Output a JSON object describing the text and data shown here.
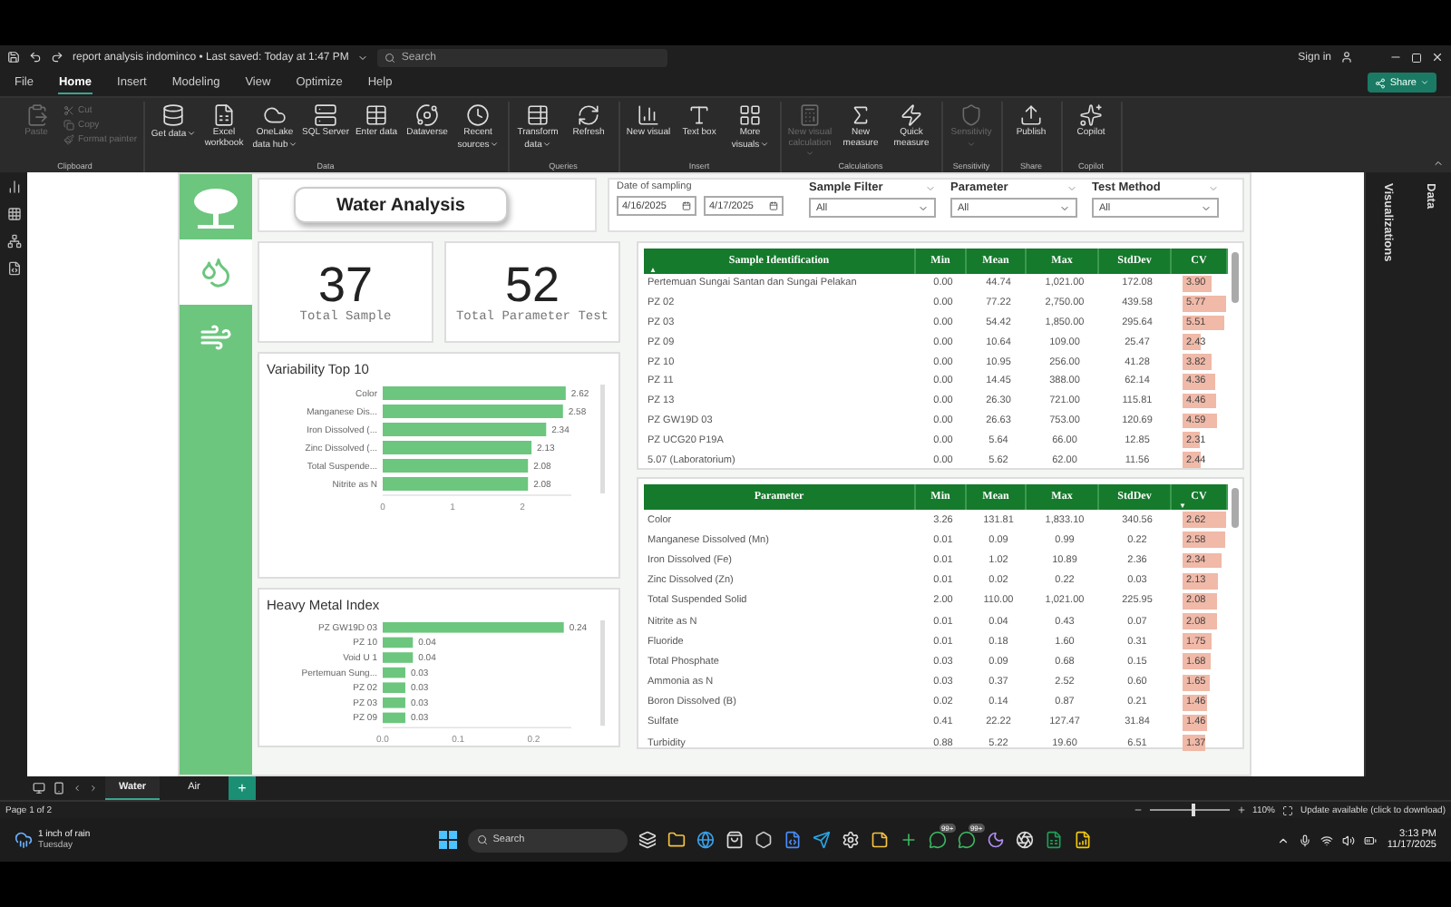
{
  "title_bar": {
    "title": "report analysis indominco • Last saved: Today at 1:47 PM",
    "search_placeholder": "Search",
    "sign_in": "Sign in"
  },
  "menu": [
    {
      "label": "File",
      "selected": false
    },
    {
      "label": "Home",
      "selected": true
    },
    {
      "label": "Insert",
      "selected": false
    },
    {
      "label": "Modeling",
      "selected": false
    },
    {
      "label": "View",
      "selected": false
    },
    {
      "label": "Optimize",
      "selected": false
    },
    {
      "label": "Help",
      "selected": false
    }
  ],
  "share_button": "Share",
  "ribbon": [
    {
      "group": "Clipboard",
      "buttons": [
        {
          "label": "Paste",
          "kind": "large",
          "disabled": true,
          "dropdown": false
        },
        {
          "label": "Cut",
          "kind": "small",
          "disabled": true
        },
        {
          "label": "Copy",
          "kind": "small",
          "disabled": true
        },
        {
          "label": "Format painter",
          "kind": "small",
          "disabled": true
        }
      ]
    },
    {
      "group": "Data",
      "buttons": [
        {
          "label": "Get data",
          "kind": "large",
          "disabled": false,
          "dropdown": true
        },
        {
          "label": "Excel workbook",
          "kind": "large",
          "disabled": false,
          "dropdown": false
        },
        {
          "label": "OneLake data hub",
          "kind": "large",
          "disabled": false,
          "dropdown": true
        },
        {
          "label": "SQL Server",
          "kind": "large",
          "disabled": false,
          "dropdown": false
        },
        {
          "label": "Enter data",
          "kind": "large",
          "disabled": false,
          "dropdown": false
        },
        {
          "label": "Dataverse",
          "kind": "large",
          "disabled": false,
          "dropdown": false
        },
        {
          "label": "Recent sources",
          "kind": "large",
          "disabled": false,
          "dropdown": true
        }
      ]
    },
    {
      "group": "Queries",
      "buttons": [
        {
          "label": "Transform data",
          "kind": "large",
          "disabled": false,
          "dropdown": true
        },
        {
          "label": "Refresh",
          "kind": "large",
          "disabled": false,
          "dropdown": false
        }
      ]
    },
    {
      "group": "Insert",
      "buttons": [
        {
          "label": "New visual",
          "kind": "large",
          "disabled": false,
          "dropdown": false
        },
        {
          "label": "Text box",
          "kind": "large",
          "disabled": false,
          "dropdown": false
        },
        {
          "label": "More visuals",
          "kind": "large",
          "disabled": false,
          "dropdown": true
        }
      ]
    },
    {
      "group": "Calculations",
      "buttons": [
        {
          "label": "New visual calculation",
          "kind": "large",
          "disabled": true,
          "dropdown": true
        },
        {
          "label": "New measure",
          "kind": "large",
          "disabled": false,
          "dropdown": false
        },
        {
          "label": "Quick measure",
          "kind": "large",
          "disabled": false,
          "dropdown": false
        }
      ]
    },
    {
      "group": "Sensitivity",
      "buttons": [
        {
          "label": "Sensitivity",
          "kind": "large",
          "disabled": true,
          "dropdown": true
        }
      ]
    },
    {
      "group": "Share",
      "buttons": [
        {
          "label": "Publish",
          "kind": "large",
          "disabled": false,
          "dropdown": false
        }
      ]
    },
    {
      "group": "Copilot",
      "buttons": [
        {
          "label": "Copilot",
          "kind": "large",
          "disabled": false,
          "dropdown": false
        }
      ]
    }
  ],
  "report": {
    "title": "Water Analysis",
    "nav_buttons": [
      {
        "kind": "water",
        "selected": true
      },
      {
        "kind": "air",
        "selected": false
      }
    ],
    "date_slicer": {
      "label": "Date of sampling",
      "from": "4/16/2025",
      "to": "4/17/2025"
    },
    "dropdowns": [
      {
        "label": "Sample Filter",
        "value": "All"
      },
      {
        "label": "Parameter",
        "value": "All"
      },
      {
        "label": "Test Method",
        "value": "All"
      }
    ],
    "cards": [
      {
        "value": "37",
        "label": "Total Sample"
      },
      {
        "value": "52",
        "label": "Total Parameter Test"
      }
    ],
    "charts": [
      {
        "title": "Variability Top 10",
        "chart_data": {
          "type": "bar",
          "orientation": "horizontal",
          "categories": [
            "Color",
            "Manganese Dis...",
            "Iron Dissolved (...",
            "Zinc Dissolved (...",
            "Total Suspende...",
            "Nitrite as N"
          ],
          "series": [
            {
              "color": "#6cc67e",
              "values": [
                2.62,
                2.58,
                2.34,
                2.13,
                2.08,
                2.08
              ]
            }
          ],
          "xlim": [
            0,
            2.7
          ],
          "xticks": [
            0,
            1,
            2
          ],
          "data_labels": true,
          "value_labels": [
            "2.62",
            "2.58",
            "2.34",
            "2.13",
            "2.08",
            "2.08"
          ]
        }
      },
      {
        "title": "Heavy Metal Index",
        "chart_data": {
          "type": "bar",
          "orientation": "horizontal",
          "categories": [
            "PZ GW19D 03",
            "PZ 10",
            "Void U 1",
            "Pertemuan Sung...",
            "PZ 02",
            "PZ 03",
            "PZ 09"
          ],
          "series": [
            {
              "color": "#6cc67e",
              "values": [
                0.24,
                0.04,
                0.04,
                0.03,
                0.03,
                0.03,
                0.03
              ]
            }
          ],
          "xlim": [
            0,
            0.25
          ],
          "xticks": [
            {
              "value": 0,
              "label": "0.0"
            },
            {
              "value": 0.1,
              "label": "0.1"
            },
            {
              "value": 0.2,
              "label": "0.2"
            }
          ],
          "data_labels": true,
          "value_labels": [
            "0.24",
            "0.04",
            "0.04",
            "0.03",
            "0.03",
            "0.03",
            "0.03"
          ]
        }
      }
    ],
    "tables": [
      {
        "columns": [
          {
            "label": "Sample Identification",
            "sort_mark": "▲"
          },
          {
            "label": "Min"
          },
          {
            "label": "Mean"
          },
          {
            "label": "Max"
          },
          {
            "label": "StdDev"
          },
          {
            "label": "CV"
          }
        ],
        "rows": [
          [
            "Pertemuan Sungai Santan dan Sungai Pelakan",
            "0.00",
            "44.74",
            "1,021.00",
            "172.08",
            "3.90"
          ],
          [
            "PZ 02",
            "0.00",
            "77.22",
            "2,750.00",
            "439.58",
            "5.77"
          ],
          [
            "PZ 03",
            "0.00",
            "54.42",
            "1,850.00",
            "295.64",
            "5.51"
          ],
          [
            "PZ 09",
            "0.00",
            "10.64",
            "109.00",
            "25.47",
            "2.43"
          ],
          [
            "PZ 10",
            "0.00",
            "10.95",
            "256.00",
            "41.28",
            "3.82"
          ],
          [
            "PZ 11",
            "0.00",
            "14.45",
            "388.00",
            "62.14",
            "4.36"
          ],
          [
            "PZ 13",
            "0.00",
            "26.30",
            "721.00",
            "115.81",
            "4.46"
          ],
          [
            "PZ GW19D 03",
            "0.00",
            "26.63",
            "753.00",
            "120.69",
            "4.59"
          ],
          [
            "PZ UCG20 P19A",
            "0.00",
            "5.64",
            "66.00",
            "12.85",
            "2.31"
          ],
          [
            "5.07 (Laboratorium)",
            "0.00",
            "5.62",
            "62.00",
            "11.56",
            "2.44"
          ]
        ]
      },
      {
        "columns": [
          {
            "label": "Parameter"
          },
          {
            "label": "Min"
          },
          {
            "label": "Mean"
          },
          {
            "label": "Max"
          },
          {
            "label": "StdDev"
          },
          {
            "label": "CV",
            "sort_mark": "▼"
          }
        ],
        "rows": [
          [
            "Color",
            "3.26",
            "131.81",
            "1,833.10",
            "340.56",
            "2.62"
          ],
          [
            "Manganese Dissolved (Mn)",
            "0.01",
            "0.09",
            "0.99",
            "0.22",
            "2.58"
          ],
          [
            "Iron Dissolved (Fe)",
            "0.01",
            "1.02",
            "10.89",
            "2.36",
            "2.34"
          ],
          [
            "Zinc Dissolved (Zn)",
            "0.01",
            "0.02",
            "0.22",
            "0.03",
            "2.13"
          ],
          [
            "Total Suspended Solid",
            "2.00",
            "110.00",
            "1,021.00",
            "225.95",
            "2.08"
          ],
          [
            "Nitrite as N",
            "0.01",
            "0.04",
            "0.43",
            "0.07",
            "2.08"
          ],
          [
            "Fluoride",
            "0.01",
            "0.18",
            "1.60",
            "0.31",
            "1.75"
          ],
          [
            "Total Phosphate",
            "0.03",
            "0.09",
            "0.68",
            "0.15",
            "1.68"
          ],
          [
            "Ammonia as N",
            "0.03",
            "0.37",
            "2.52",
            "0.60",
            "1.65"
          ],
          [
            "Boron Dissolved (B)",
            "0.02",
            "0.14",
            "0.87",
            "0.21",
            "1.46"
          ],
          [
            "Sulfate",
            "0.41",
            "22.22",
            "127.47",
            "31.84",
            "1.46"
          ],
          [
            "Turbidity",
            "0.88",
            "5.22",
            "19.60",
            "6.51",
            "1.37"
          ]
        ]
      }
    ]
  },
  "side_panes": [
    "Visualizations",
    "Data"
  ],
  "page_tabs": [
    {
      "label": "Water",
      "selected": true
    },
    {
      "label": "Air",
      "selected": false
    }
  ],
  "add_page": "+",
  "status_bar": {
    "page": "Page 1 of 2",
    "zoom": "110%",
    "zoom_level": {
      "level": 0.55
    },
    "update": "Update available (click to download)"
  },
  "taskbar": {
    "weather": "1 inch of rain",
    "weather_day": "Tuesday",
    "search_placeholder": "Search",
    "badges": [
      "99+",
      "99+"
    ],
    "time": "3:13 PM",
    "date": "11/17/2025"
  }
}
